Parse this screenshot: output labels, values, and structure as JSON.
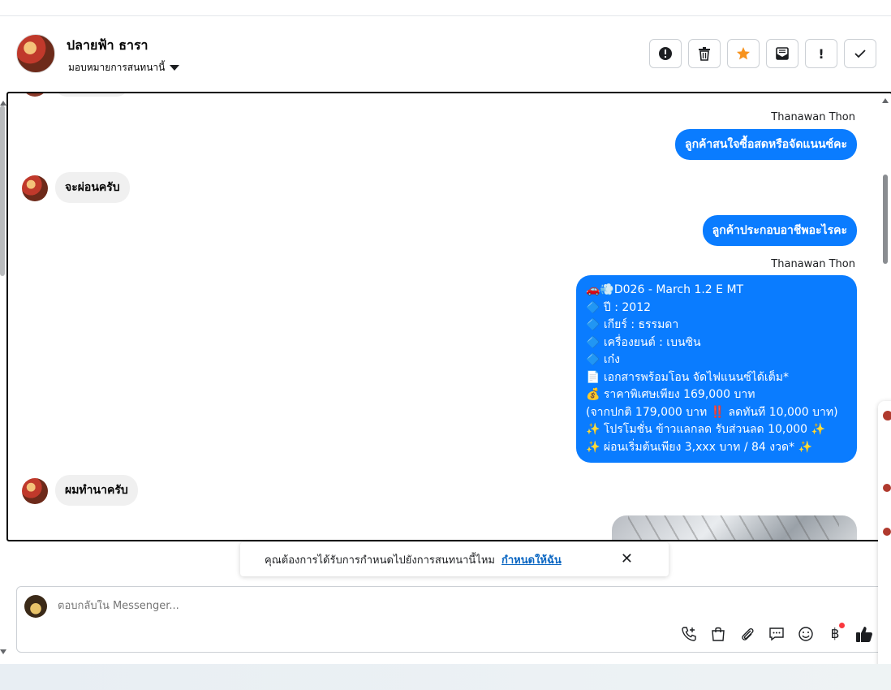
{
  "header": {
    "contact_name": "ปลายฟ้า ธารา",
    "assign_label": "มอบหมายการสนทนานี้",
    "toolbar": [
      {
        "name": "spam-button",
        "icon": "alert-circle-icon",
        "glyph": "⬤!"
      },
      {
        "name": "delete-button",
        "icon": "trash-icon",
        "glyph": "🗑"
      },
      {
        "name": "star-button",
        "icon": "star-icon",
        "glyph": "★"
      },
      {
        "name": "mark-unread-button",
        "icon": "envelope-icon",
        "glyph": "✉"
      },
      {
        "name": "important-button",
        "icon": "exclamation-icon",
        "glyph": "!"
      },
      {
        "name": "done-button",
        "icon": "check-icon",
        "glyph": "✓"
      }
    ]
  },
  "messages": {
    "sender1": "Thanawan Thon",
    "out1": "ลูกค้าสนใจซื้อสดหรือจัดแนนซ์คะ",
    "in1": "จะผ่อนครับ",
    "out2": "ลูกค้าประกอบอาชีพอะไรคะ",
    "sender2": "Thanawan Thon",
    "listing": [
      "🚗💨D026 - March 1.2 E MT",
      "🔷 ปี : 2012",
      "🔷 เกียร์ : ธรรมดา",
      "🔷 เครื่องยนต์ : เบนซิน",
      "🔷 เก๋ง",
      "📄 เอกสารพร้อมโอน จัดไฟแนนซ์ได้เต็ม*",
      "💰 ราคาพิเศษเพียง 169,000 บาท",
      "(จากปกติ 179,000 บาท ‼️ ลดทันที 10,000 บาท)",
      "✨ โปรโมชั่น ข้าวแลกลด รับส่วนลด 10,000 ✨",
      "✨ ผ่อนเริ่มต้นเพียง 3,xxx บาท / 84 งวด* ✨"
    ],
    "in2": "ผมทำนาครับ"
  },
  "notice": {
    "text": "คุณต้องการได้รับการกำหนดไปยังการสนทนานี้ไหม",
    "link": "กำหนดให้ฉัน",
    "close": "✕"
  },
  "composer": {
    "placeholder": "ตอบกลับใน Messenger...",
    "tools": [
      {
        "name": "call-add-icon",
        "glyph": "✆"
      },
      {
        "name": "shopping-bag-icon",
        "glyph": "🛍"
      },
      {
        "name": "attachment-icon",
        "glyph": "📎"
      },
      {
        "name": "saved-reply-icon",
        "glyph": "💬"
      },
      {
        "name": "emoji-icon",
        "glyph": "☺"
      },
      {
        "name": "payment-baht-icon",
        "glyph": "฿"
      },
      {
        "name": "thumbs-up-icon",
        "glyph": "👍"
      }
    ]
  },
  "colors": {
    "accent": "#0a7cff",
    "incoming_bubble": "#f0f0f0",
    "star": "#f7931e",
    "link": "#0a66c2"
  }
}
